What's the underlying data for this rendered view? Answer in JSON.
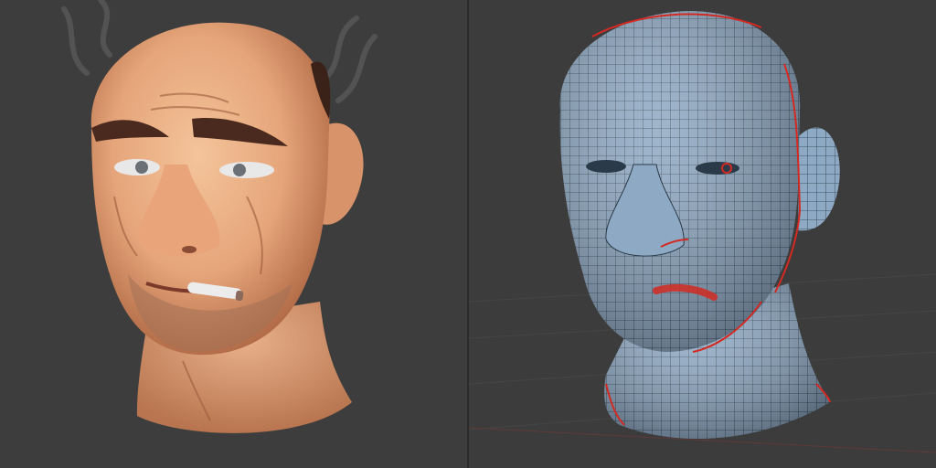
{
  "panels": [
    {
      "id": "render",
      "kind": "shaded-render"
    },
    {
      "id": "wireframe",
      "kind": "topology-wireframe"
    }
  ],
  "colors": {
    "background": "#3d3d3d",
    "skin": "#e6a57a",
    "skin_shadow": "#b9704b",
    "hair": "#3b2218",
    "mesh_surface": "#8aa9c7",
    "mesh_lines": "#1d2a36",
    "seam_lines": "#d22a22",
    "grid_lines": "#4a4a4a"
  }
}
